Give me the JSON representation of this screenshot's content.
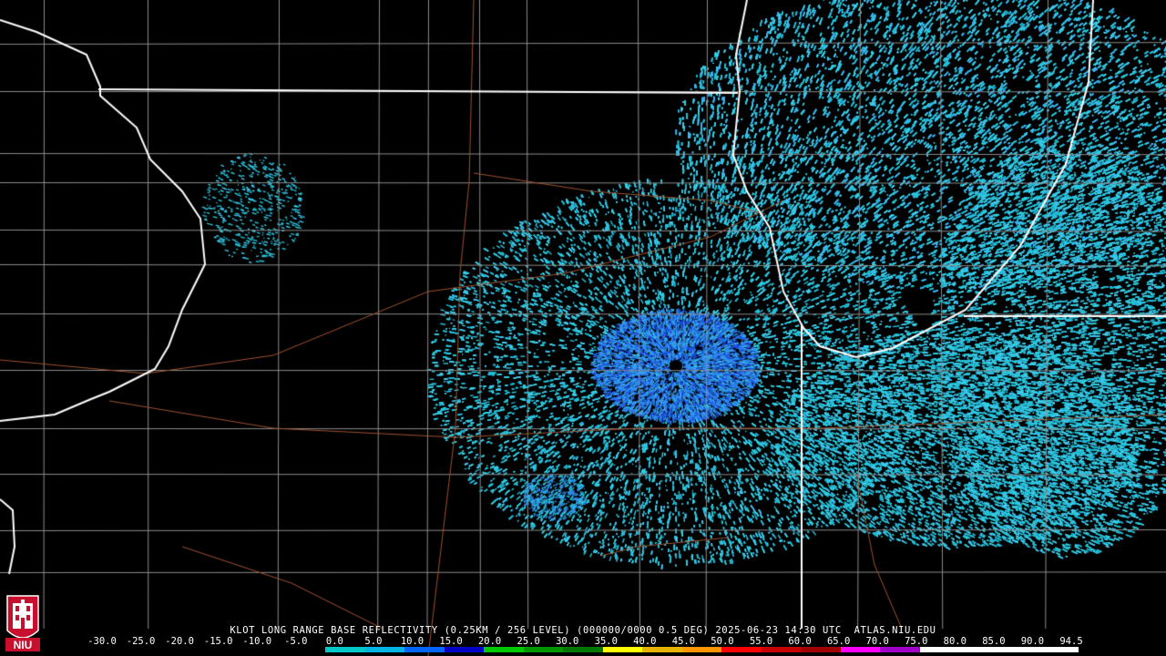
{
  "map": {
    "radar_site": "KLOT",
    "caption": "KLOT LONG RANGE BASE REFLECTIVITY (0.25KM / 256 LEVEL) (000000/0000 0.5 DEG) 2025-06-23 14:30 UTC  ATLAS.NIU.EDU",
    "logo_text": "NIU"
  },
  "legend": {
    "ticks": [
      "-30.0",
      "-25.0",
      "-20.0",
      "-15.0",
      "-10.0",
      "-5.0",
      "0.0",
      "5.0",
      "10.0",
      "15.0",
      "20.0",
      "25.0",
      "30.0",
      "35.0",
      "40.0",
      "45.0",
      "50.0",
      "55.0",
      "60.0",
      "65.0",
      "70.0",
      "75.0",
      "80.0",
      "85.0",
      "90.0",
      "94.5"
    ],
    "colors": [
      "#000000",
      "#000000",
      "#000000",
      "#000000",
      "#000000",
      "#000000",
      "#00c8c8",
      "#00b4e6",
      "#0064ff",
      "#0000c8",
      "#00c800",
      "#009600",
      "#007800",
      "#ffff00",
      "#e6b400",
      "#ff9600",
      "#ff0000",
      "#c80000",
      "#a00000",
      "#ff00ff",
      "#a000c8",
      "#ffffff",
      "#ffffff",
      "#ffffff",
      "#ffffff"
    ]
  },
  "colors": {
    "state_border": "#ffffff",
    "county_border": "#8c8c8c",
    "highway": "#a0522d",
    "echo_light": "#29c4dc",
    "echo_mid": "#2a8cf0",
    "echo_core": "#1e50e6"
  }
}
